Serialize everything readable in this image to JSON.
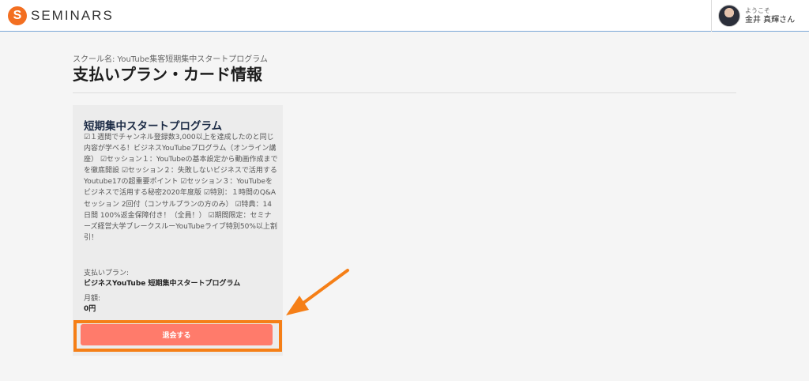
{
  "header": {
    "logo_mark": "S",
    "logo_text": "SEMINARS",
    "user_greeting": "ようこそ",
    "user_name": "金井 真輝さん"
  },
  "page": {
    "school_name": "スクール名: YouTube集客短期集中スタートプログラム",
    "title": "支払いプラン・カード情報"
  },
  "plan": {
    "name": "短期集中スタートプログラム",
    "description": "☑１週間でチャンネル登録数3,000以上を達成したのと同じ内容が学べる！ビジネスYouTubeプログラム（オンライン講座） ☑セッション１：YouTubeの基本設定から動画作成までを徹底開設 ☑セッション２：失敗しないビジネスで活用するYoutube17の超重要ポイント ☑セッション３：YouTubeをビジネスで活用する秘密2020年度版 ☑特別：１時間のQ&Aセッション 2回付（コンサルプランの方のみ） ☑特典：14日間 100%返金保障付き！（全員！） ☑期間限定：セミナーズ経営大学ブレークスルーYouTubeライブ特別50%以上割引！",
    "payment_plan_label": "支払いプラン:",
    "payment_plan_value": "ビジネスYouTube 短期集中スタートプログラム",
    "monthly_label": "月額:",
    "monthly_value": "0円",
    "leave_button": "退会する"
  },
  "colors": {
    "brand_orange": "#f36f21",
    "highlight": "#f57f17",
    "button": "#ff7b6b"
  }
}
